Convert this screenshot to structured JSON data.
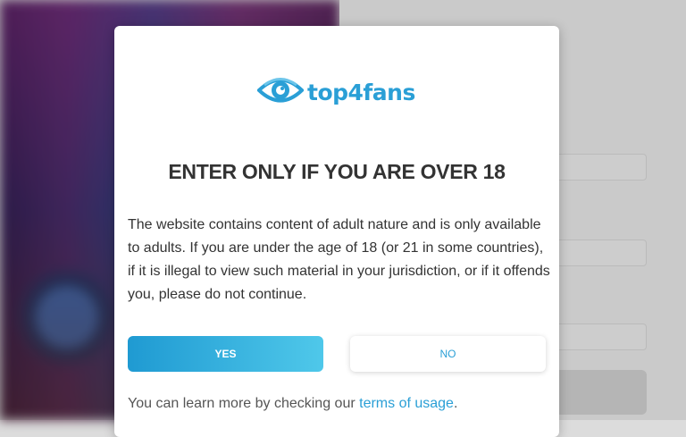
{
  "logo": {
    "text": "top4fans",
    "icon": "eye-icon",
    "color": "#2a9fd6"
  },
  "modal": {
    "title": "ENTER ONLY IF YOU ARE OVER 18",
    "body": "The website contains content of adult nature and is only available to adults. If you are under the age of 18 (or 21 in some countries), if it is illegal to view such material in your jurisdiction, or if it offends you, please do not continue.",
    "yes_label": "YES",
    "no_label": "NO",
    "footer_prefix": "You can learn more by checking our ",
    "footer_link": "terms of usage",
    "footer_suffix": "."
  },
  "colors": {
    "accent": "#2a9fd6",
    "yes_gradient_start": "#1f9ad2",
    "yes_gradient_end": "#4fc8ea",
    "text": "#333333"
  }
}
